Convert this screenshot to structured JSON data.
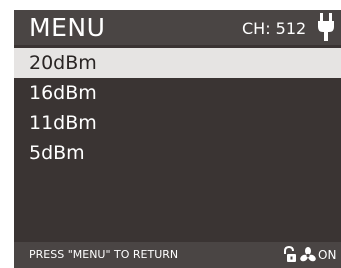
{
  "header": {
    "title": "MENU",
    "channel": "CH: 512",
    "power_icon": "plug-icon"
  },
  "menu": {
    "items": [
      {
        "label": "20dBm",
        "selected": true
      },
      {
        "label": "16dBm",
        "selected": false
      },
      {
        "label": "11dBm",
        "selected": false
      },
      {
        "label": "5dBm",
        "selected": false
      }
    ]
  },
  "footer": {
    "hint": "PRESS \"MENU\" TO RETURN",
    "lock_icon": "unlocked-padlock-icon",
    "fan_icon": "fan-icon",
    "status": "ON"
  },
  "colors": {
    "background": "#3a3433",
    "bar": "#4a4544",
    "selected": "#e6e4e3",
    "text": "#ffffff"
  }
}
